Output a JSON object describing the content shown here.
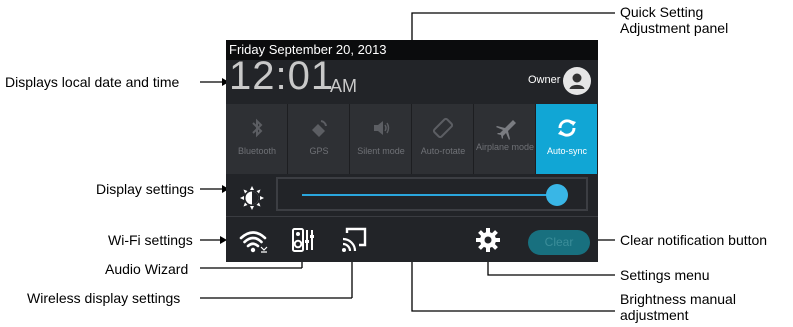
{
  "status": {
    "date": "Friday September 20, 2013",
    "time": "12:01",
    "ampm": "AM",
    "user": "Owner"
  },
  "quick_settings": [
    {
      "label": "Bluetooth",
      "icon": "bluetooth-icon",
      "active": false
    },
    {
      "label": "GPS",
      "icon": "gps-icon",
      "active": false
    },
    {
      "label": "Silent mode",
      "icon": "silent-mode-icon",
      "active": false
    },
    {
      "label": "Auto-rotate",
      "icon": "auto-rotate-icon",
      "active": false
    },
    {
      "label": "Airplane mode",
      "icon": "airplane-icon",
      "active": false
    },
    {
      "label": "Auto-sync",
      "icon": "sync-icon",
      "active": true
    }
  ],
  "brightness": {
    "level": 0.95
  },
  "bottom": {
    "clear_label": "Clear"
  },
  "callouts": {
    "date_time": "Displays local date and time",
    "display_settings": "Display settings",
    "wifi_settings": "Wi-Fi settings",
    "audio_wizard": "Audio Wizard",
    "wireless_display": "Wireless display settings",
    "quick_setting_1": "Quick Setting",
    "quick_setting_2": "Adjustment panel",
    "clear_notification": "Clear notification button",
    "settings_menu": "Settings menu",
    "brightness_1": "Brightness manual",
    "brightness_2": "adjustment"
  },
  "colors": {
    "accent": "#11a6d5",
    "panel": "#222428",
    "tile": "#2e3034",
    "clear": "#18707f"
  }
}
